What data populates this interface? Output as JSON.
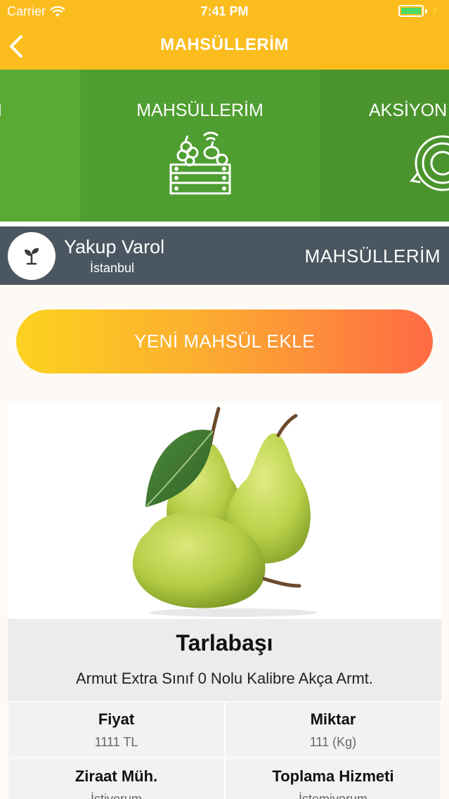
{
  "status_bar": {
    "carrier": "Carrier",
    "time": "7:41 PM"
  },
  "nav": {
    "title": "MAHSÜLLERİM"
  },
  "categories": [
    {
      "label": "İM",
      "icon": "category-partial-icon"
    },
    {
      "label": "MAHSÜLLERİM",
      "icon": "crate-icon"
    },
    {
      "label": "AKSİYON",
      "icon": "gear-icon"
    }
  ],
  "user": {
    "name": "Yakup Varol",
    "city": "İstanbul",
    "section": "MAHSÜLLERİM",
    "avatar_icon": "sprout-icon"
  },
  "add_button": {
    "label": "YENİ MAHSÜL EKLE"
  },
  "product": {
    "image_icon": "pear-image",
    "title": "Tarlabaşı",
    "description": "Armut Extra Sınıf 0 Nolu Kalibre Akça Armt.",
    "fields": [
      {
        "label": "Fiyat",
        "value": "1111 TL"
      },
      {
        "label": "Miktar",
        "value": "111 (Kg)"
      },
      {
        "label": "Ziraat Müh.",
        "value": "İstiyorum"
      },
      {
        "label": "Toplama Hizmeti",
        "value": "İstemiyorum"
      }
    ]
  },
  "colors": {
    "accent": "#fbbd1e",
    "green": "#4f9e31",
    "userbar": "#4a5762"
  }
}
